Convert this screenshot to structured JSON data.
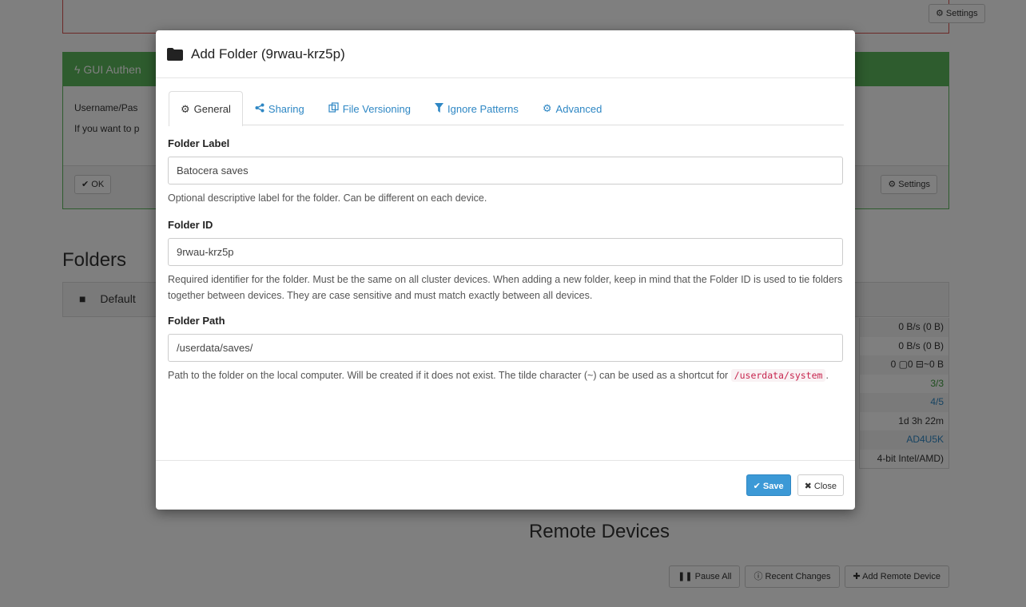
{
  "background": {
    "top_settings_label": "Settings",
    "gui_auth": {
      "header": "GUI Authen",
      "line1": "Username/Pas",
      "line2": "If you want to p",
      "ok_label": "OK",
      "settings_label": "Settings"
    },
    "folders_title": "Folders",
    "default_folder": "Default",
    "stats": [
      "0 B/s (0 B)",
      "0 B/s (0 B)",
      "0 ▢0 ⊟~0 B",
      "3/3",
      "4/5",
      "1d 3h 22m",
      "AD4U5K",
      "4-bit Intel/AMD)"
    ],
    "remote_devices_title": "Remote Devices",
    "pause_all": "Pause All",
    "recent_changes": "Recent Changes",
    "add_remote_device": "Add Remote Device"
  },
  "modal": {
    "title": "Add Folder (9rwau-krz5p)",
    "tabs": [
      {
        "label": "General",
        "icon": "gear-icon"
      },
      {
        "label": "Sharing",
        "icon": "share-icon"
      },
      {
        "label": "File Versioning",
        "icon": "copy-icon"
      },
      {
        "label": "Ignore Patterns",
        "icon": "filter-icon"
      },
      {
        "label": "Advanced",
        "icon": "gears-icon"
      }
    ],
    "folder_label": {
      "label": "Folder Label",
      "value": "Batocera saves",
      "help": "Optional descriptive label for the folder. Can be different on each device."
    },
    "folder_id": {
      "label": "Folder ID",
      "value": "9rwau-krz5p",
      "help": "Required identifier for the folder. Must be the same on all cluster devices. When adding a new folder, keep in mind that the Folder ID is used to tie folders together between devices. They are case sensitive and must match exactly between all devices."
    },
    "folder_path": {
      "label": "Folder Path",
      "value": "/userdata/saves/",
      "help_prefix": "Path to the folder on the local computer. Will be created if it does not exist. The tilde character (~) can be used as a shortcut for ",
      "help_code": "/userdata/system",
      "help_suffix": "."
    },
    "save_label": "Save",
    "close_label": "Close"
  },
  "colors": {
    "accent": "#2e87c4",
    "success": "#5cb85c",
    "danger": "#d9534f",
    "primary_button": "#3c99d6"
  }
}
